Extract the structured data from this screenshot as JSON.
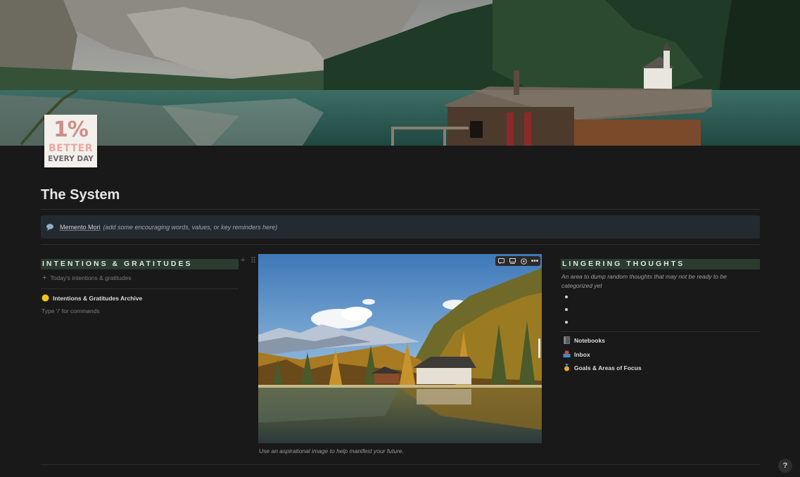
{
  "page": {
    "title": "The System",
    "icon": {
      "line1": "1%",
      "line2": "BETTER",
      "line3": "EVERY DAY"
    }
  },
  "callout": {
    "icon": "speech-bubble-icon",
    "label": "Memento Mori",
    "note": "(add some encouraging words, values, or key reminders here)"
  },
  "left_column": {
    "heading": "INTENTIONS & GRATITUDES",
    "add_label": "Today's intentions & gratitudes",
    "archive_link": {
      "icon": "yellow-circle-icon",
      "label": "Intentions & Gratitudes Archive"
    },
    "placeholder": "Type '/' for commands"
  },
  "middle_column": {
    "caption": "Use an aspirational image to help manifest your future.",
    "toolbar_icons": [
      "comment-icon",
      "caption-icon",
      "crop-icon",
      "more-icon"
    ]
  },
  "right_column": {
    "heading": "LINGERING THOUGHTS",
    "description": "An area to dump random thoughts that may not be ready to be categorized yet",
    "links": [
      {
        "icon": "notebook-icon",
        "label": "Notebooks"
      },
      {
        "icon": "inbox-tray-icon",
        "label": "Inbox"
      },
      {
        "icon": "medal-icon",
        "label": "Goals & Areas of Focus"
      }
    ]
  },
  "help": {
    "label": "?"
  }
}
